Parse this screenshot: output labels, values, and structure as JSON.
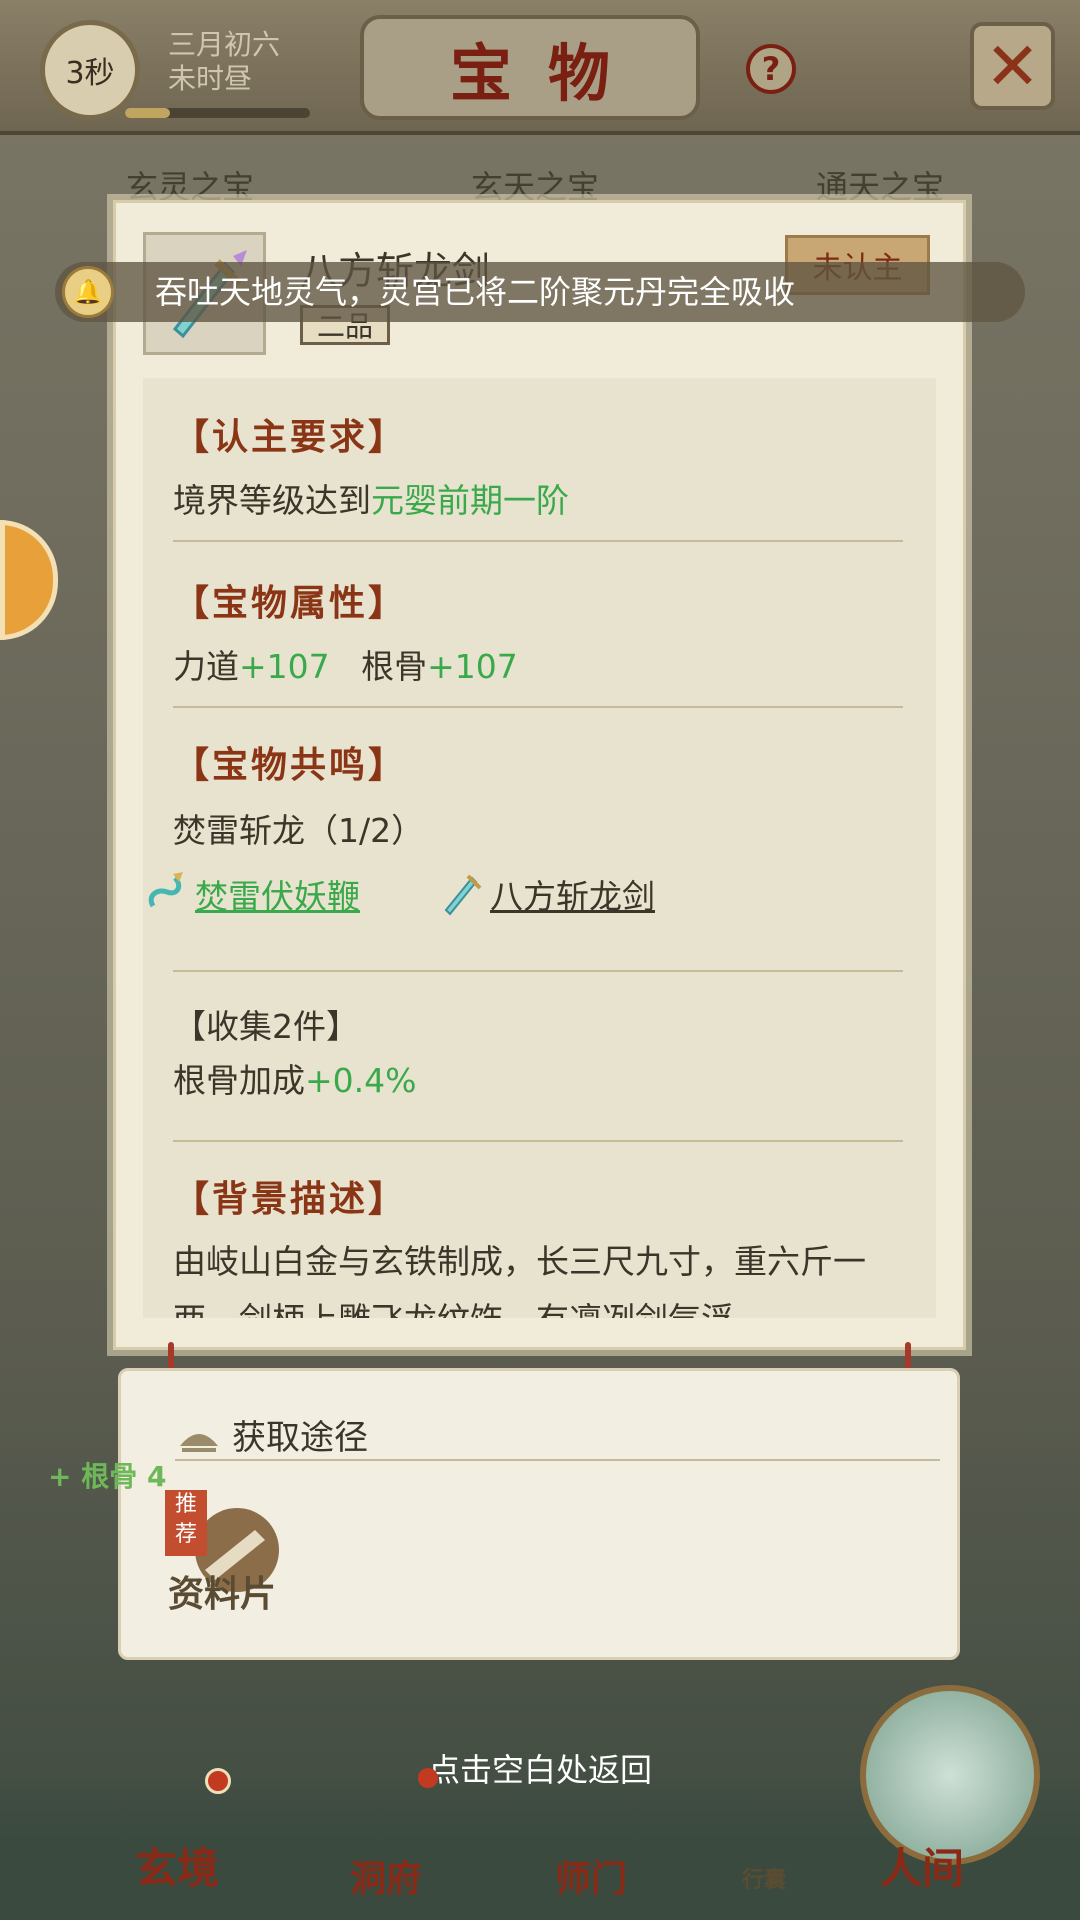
{
  "top": {
    "timer": "3秒",
    "date_line1": "三月初六",
    "date_line2": "未时昼",
    "title": "宝物",
    "help_glyph": "?",
    "close_glyph": "✕"
  },
  "tabs": [
    "玄灵之宝",
    "玄天之宝",
    "通天之宝"
  ],
  "toast": {
    "text": "吞吐天地灵气，灵宫已将二阶聚元丹完全吸收",
    "icon": "bell-icon"
  },
  "item": {
    "name": "八方斩龙剑",
    "grade": "二品",
    "status": "未认主",
    "icon": "sword-icon"
  },
  "requirement": {
    "title": "【认主要求】",
    "prefix": "境界等级达到",
    "level": "元婴前期一阶"
  },
  "attributes": {
    "title": "【宝物属性】",
    "attr1_name": "力道",
    "attr1_value": "+107",
    "attr2_name": "根骨",
    "attr2_value": "+107"
  },
  "resonance": {
    "title": "【宝物共鸣】",
    "set_name": "焚雷斩龙（1/2）",
    "link1": "焚雷伏妖鞭",
    "link2": "八方斩龙剑",
    "collect_title": "【收集2件】",
    "bonus_name": "根骨加成",
    "bonus_value": "+0.4%"
  },
  "background": {
    "title": "【背景描述】",
    "text": "由岐山白金与玄铁制成，长三尺九寸，重六斤一两，剑柄上雕飞龙纹饰，有凛冽剑气浮"
  },
  "acquisition": {
    "title": "获取途径",
    "badge": "推荐",
    "source": "资料片",
    "side_bonus": "+ 根骨 4"
  },
  "hint": "点击空白处返回",
  "nav": [
    "玄境",
    "洞府",
    "师门",
    "行囊",
    "人间"
  ],
  "colors": {
    "accent_red": "#8a3516",
    "green": "#3aa94b",
    "card_bg": "#f1ecd9"
  }
}
